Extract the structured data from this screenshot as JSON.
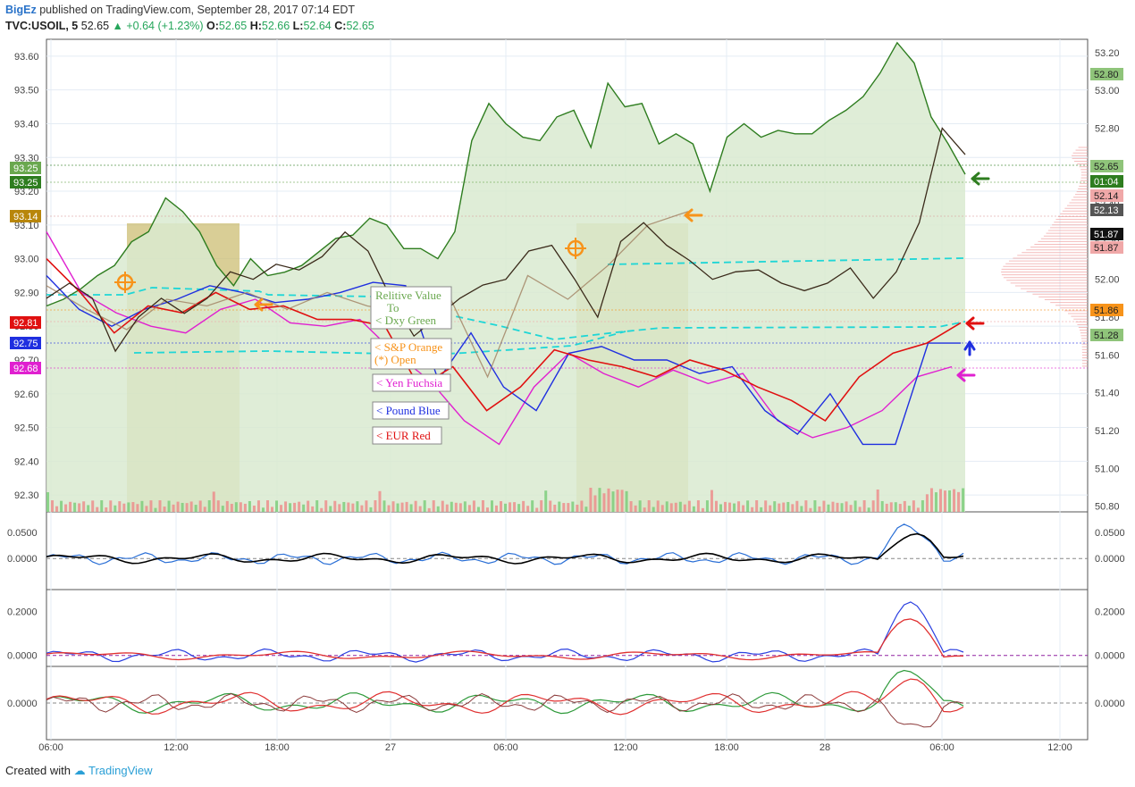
{
  "header": {
    "author": "BigEz",
    "published": "published on TradingView.com, September 28, 2017 07:14 EDT",
    "symbol": "TVC:USOIL, 5",
    "last": "52.65",
    "change": "+0.64 (+1.23%)",
    "o_label": "O:",
    "o": "52.65",
    "h_label": "H:",
    "h": "52.66",
    "l_label": "L:",
    "l": "52.64",
    "c_label": "C:",
    "c": "52.65"
  },
  "footer": {
    "created_with": "Created with",
    "brand": "TradingView"
  },
  "colors": {
    "oil": "#3a2a1a",
    "dxy": "#2e7d1f",
    "dxy_fill": "#d9ead0",
    "sp": "#f7931a",
    "yen": "#e020d0",
    "pound": "#1f2fe0",
    "eur": "#e01010",
    "cyan": "#1fd6d6",
    "session": "#c9b96a"
  },
  "notes": {
    "dxy": [
      "Relitive Value",
      "To",
      "< Dxy Green"
    ],
    "sp": [
      "< S&P Orange",
      "(*) Open"
    ],
    "yen": "< Yen Fuchsia",
    "pound": "< Pound Blue",
    "eur": "< EUR Red"
  },
  "left_badges": [
    {
      "text": "93.25",
      "color": "#6aa84f"
    },
    {
      "text": "93.25",
      "color": "#2e7d1f"
    },
    {
      "text": "93.14",
      "color": "#b8860b"
    },
    {
      "text": "92.81",
      "color": "#e01010"
    },
    {
      "text": "92.75",
      "color": "#1f2fe0"
    },
    {
      "text": "92.68",
      "color": "#e020d0"
    }
  ],
  "right_badges": [
    {
      "text": "52.80",
      "color": "#8fc47a",
      "fg": "#222"
    },
    {
      "text": "52.65",
      "color": "#8fc47a",
      "fg": "#222"
    },
    {
      "text": "01:04",
      "color": "#2e7d1f",
      "fg": "#fff"
    },
    {
      "text": "52.14",
      "color": "#f0a8a8",
      "fg": "#222"
    },
    {
      "text": "52.13",
      "color": "#555555",
      "fg": "#fff"
    },
    {
      "text": "51.87",
      "color": "#111111",
      "fg": "#fff"
    },
    {
      "text": "51.87",
      "color": "#f0a8a8",
      "fg": "#222"
    },
    {
      "text": "51.86",
      "color": "#f7931a",
      "fg": "#222"
    },
    {
      "text": "51.28",
      "color": "#8fc47a",
      "fg": "#222"
    }
  ],
  "chart_data": [
    {
      "type": "line",
      "title": "TVC:USOIL, 5",
      "x_labels": [
        "06:00",
        "12:00",
        "18:00",
        "27",
        "06:00",
        "12:00",
        "18:00",
        "28",
        "06:00",
        "12:00"
      ],
      "left_axis": {
        "ticks": [
          "93.60",
          "93.50",
          "93.40",
          "93.30",
          "93.20",
          "93.10",
          "93.00",
          "92.90",
          "92.80",
          "92.70",
          "92.60",
          "92.50",
          "92.40",
          "92.30"
        ],
        "ylim": [
          92.25,
          93.65
        ]
      },
      "right_axis": {
        "ticks": [
          "53.20",
          "53.00",
          "52.80",
          "52.60",
          "52.40",
          "52.20",
          "52.00",
          "51.80",
          "51.60",
          "51.40",
          "51.20",
          "51.00",
          "50.80"
        ],
        "ylim": [
          50.77,
          53.27
        ]
      },
      "series": [
        {
          "name": "Dxy Green",
          "axis": "left",
          "values": [
            92.86,
            92.88,
            92.91,
            92.95,
            92.98,
            93.05,
            93.08,
            93.18,
            93.14,
            93.08,
            92.98,
            92.92,
            93.0,
            92.95,
            92.96,
            92.98,
            93.02,
            93.06,
            93.07,
            93.12,
            93.1,
            93.03,
            93.03,
            93.0,
            93.08,
            93.35,
            93.46,
            93.4,
            93.36,
            93.35,
            93.42,
            93.44,
            93.33,
            93.52,
            93.45,
            93.46,
            93.34,
            93.37,
            93.34,
            93.2,
            93.36,
            93.4,
            93.36,
            93.38,
            93.37,
            93.37,
            93.41,
            93.44,
            93.48,
            93.55,
            93.64,
            93.58,
            93.42,
            93.34,
            93.25
          ]
        },
        {
          "name": "USOIL",
          "axis": "right",
          "values": [
            51.9,
            51.98,
            51.9,
            51.62,
            51.8,
            51.9,
            51.82,
            51.9,
            52.04,
            52.0,
            52.08,
            52.05,
            52.12,
            52.25,
            52.15,
            51.9,
            51.7,
            51.8,
            51.9,
            51.97,
            52.0,
            52.15,
            52.18,
            52.0,
            51.8,
            52.2,
            52.3,
            52.18,
            52.1,
            52.0,
            52.04,
            52.05,
            51.98,
            51.94,
            51.98,
            52.06,
            51.9,
            52.04,
            52.3,
            52.8,
            52.66
          ]
        },
        {
          "name": "S&P Orange",
          "axis": "left",
          "values": [
            92.92,
            92.85,
            92.79,
            92.88,
            92.86,
            92.9,
            92.85,
            92.9,
            92.86,
            92.84,
            92.9,
            92.65,
            92.95,
            92.88,
            92.98,
            93.1,
            93.14
          ]
        },
        {
          "name": "Yen Fuchsia",
          "axis": "left",
          "values": [
            93.08,
            92.9,
            92.84,
            92.8,
            92.78,
            92.85,
            92.88,
            92.81,
            92.8,
            92.82,
            92.72,
            92.64,
            92.52,
            92.45,
            92.62,
            92.72,
            92.66,
            92.62,
            92.67,
            92.63,
            92.66,
            92.52,
            92.47,
            92.5,
            92.55,
            92.65,
            92.68
          ]
        },
        {
          "name": "Pound Blue",
          "axis": "left",
          "values": [
            92.95,
            92.85,
            92.8,
            92.85,
            92.88,
            92.92,
            92.9,
            92.87,
            92.88,
            92.9,
            92.93,
            92.92,
            92.64,
            92.78,
            92.62,
            92.55,
            92.72,
            92.74,
            92.7,
            92.7,
            92.66,
            92.68,
            92.55,
            92.48,
            92.6,
            92.45,
            92.45,
            92.75,
            92.75
          ]
        },
        {
          "name": "EUR Red",
          "axis": "left",
          "values": [
            93.0,
            92.9,
            92.78,
            92.86,
            92.84,
            92.9,
            92.85,
            92.86,
            92.82,
            92.82,
            92.8,
            92.62,
            92.68,
            92.55,
            92.62,
            92.73,
            92.7,
            92.68,
            92.65,
            92.7,
            92.67,
            92.62,
            92.58,
            92.52,
            92.65,
            92.72,
            92.75,
            92.81
          ]
        }
      ]
    },
    {
      "type": "line",
      "title": "",
      "ticks": [
        "0.0500",
        "0.0000"
      ],
      "ylim": [
        -0.06,
        0.09
      ]
    },
    {
      "type": "line",
      "title": "",
      "ticks": [
        "0.2000",
        "0.0000"
      ],
      "ylim": [
        -0.05,
        0.3
      ]
    },
    {
      "type": "line",
      "title": "",
      "ticks": [
        "0.0000"
      ],
      "ylim": [
        -0.07,
        0.07
      ]
    }
  ]
}
